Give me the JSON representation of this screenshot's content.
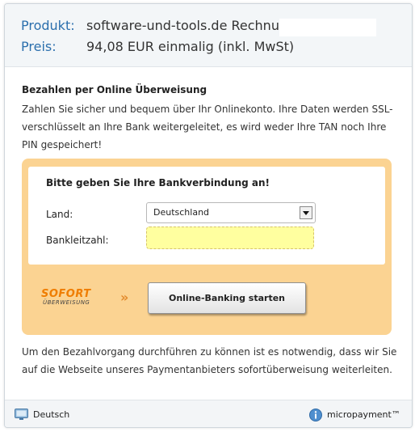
{
  "header": {
    "product_label": "Produkt:",
    "product_value": "software-und-tools.de Rechnung",
    "price_label": "Preis:",
    "price_value": "94,08 EUR einmalig (inkl. MwSt)"
  },
  "payment": {
    "title": "Bezahlen per Online Überweisung",
    "description": "Zahlen Sie sicher und bequem über Ihr Onlinekonto. Ihre Daten werden SSL-verschlüsselt an Ihre Bank weitergeleitet, es wird weder Ihre TAN noch Ihre PIN gespeichert!"
  },
  "bank_form": {
    "title": "Bitte geben Sie Ihre Bankverbindung an!",
    "country_label": "Land:",
    "country_value": "Deutschland",
    "blz_label": "Bankleitzahl:",
    "blz_value": ""
  },
  "sofort": {
    "brand": "SOFORT",
    "brand_sub": "ÜBERWEISUNG",
    "chevron": "»",
    "start_button": "Online-Banking starten"
  },
  "note": "Um den Bezahlvorgang durchführen zu können ist es notwendig, dass wir Sie auf die Webseite unseres Paymentanbieters sofortüberweisung weiterleiten.",
  "footer": {
    "language": "Deutsch",
    "provider": "micropayment™"
  },
  "colors": {
    "accent_blue": "#2b6fad",
    "bank_box": "#fbd392",
    "input_highlight": "#ffff9f",
    "sofort_orange": "#ef7d00"
  },
  "icons": [
    "language-monitor-icon",
    "chevron-down-icon",
    "info-icon"
  ]
}
